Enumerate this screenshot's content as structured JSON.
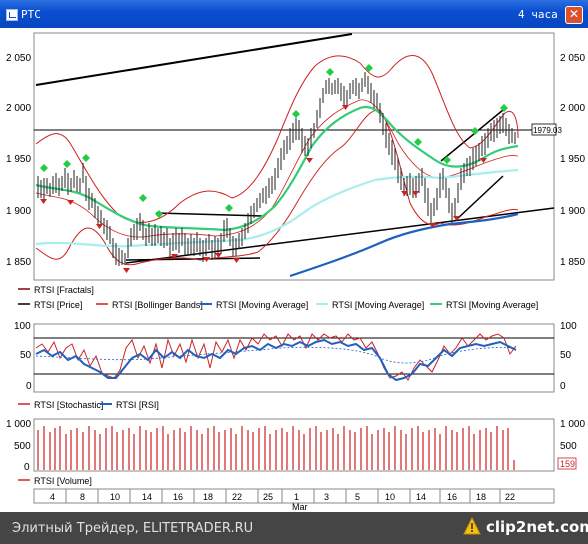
{
  "window": {
    "title": "РТС",
    "timeframe": "4 часа",
    "close_glyph": "✕"
  },
  "price_panel": {
    "y_ticks_left": [
      "2 050",
      "2 000",
      "1 950",
      "1 900",
      "1 850"
    ],
    "y_ticks_right": [
      "2 050",
      "2 000",
      "1 950",
      "1 900",
      "1 850"
    ],
    "last_price": "1979.03",
    "legend": [
      {
        "label": "RTSI [Fractals]",
        "color": "#8b0000"
      },
      {
        "label": "RTSI [Price]",
        "color": "#000000"
      },
      {
        "label": "RTSI [Bollinger Bands]",
        "color": "#cc2222"
      },
      {
        "label": "RTSI [Moving Average]",
        "color": "#2060c0"
      },
      {
        "label": "RTSI [Moving Average]",
        "color": "#a8eeee"
      },
      {
        "label": "RTSI [Moving Average]",
        "color": "#33cc77"
      }
    ]
  },
  "osc_panel": {
    "y_ticks_left": [
      "100",
      "50",
      "0"
    ],
    "y_ticks_right": [
      "100",
      "50",
      "0"
    ],
    "legend": [
      {
        "label": "RTSI [Stochastic]",
        "color": "#cc2222"
      },
      {
        "label": "RTSI [RSI]",
        "color": "#2060c0"
      }
    ]
  },
  "volume_panel": {
    "y_ticks_left": [
      "1 000",
      "500",
      "0"
    ],
    "y_ticks_right": [
      "1 000",
      "500"
    ],
    "last_volume": "159",
    "legend": [
      {
        "label": "RTSI [Volume]",
        "color": "#cc2222"
      }
    ]
  },
  "time_axis": {
    "labels": [
      "4",
      "8",
      "10",
      "14",
      "16",
      "18",
      "22",
      "25",
      "1",
      "3",
      "5",
      "10",
      "14",
      "16",
      "18",
      "22"
    ],
    "month_label": "Mar"
  },
  "footer": {
    "site_text": "Элитный Трейдер, ELITETRADER.RU",
    "logo_text": "clip2net.com"
  }
}
